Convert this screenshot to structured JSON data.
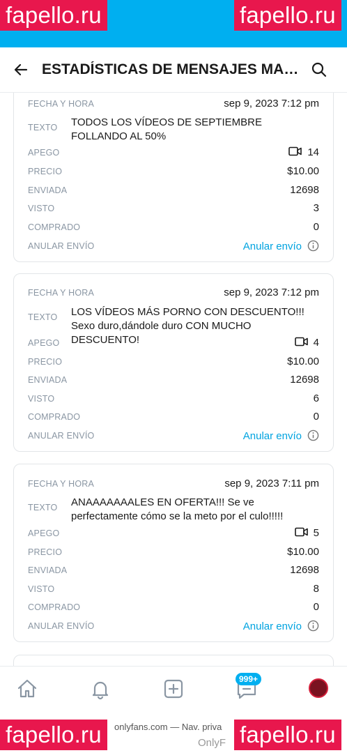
{
  "watermark": {
    "text": "fapello.ru"
  },
  "appbar": {
    "title": "ESTADÍSTICAS DE MENSAJES MAS..."
  },
  "cards": [
    {
      "fecha_label": "FECHA Y HORA",
      "fecha": "sep 9, 2023 7:12 pm",
      "texto_label": "TEXTO",
      "texto": "TODOS LOS VÍDEOS DE SEPTIEMBRE FOLLANDO AL 50%",
      "apego_label": "APEGO",
      "apego": "14",
      "precio_label": "PRECIO",
      "precio": "$10.00",
      "enviada_label": "ENVIADA",
      "enviada": "12698",
      "visto_label": "VISTO",
      "visto": "3",
      "comprado_label": "COMPRADO",
      "comprado": "0",
      "anular_label": "ANULAR ENVÍO",
      "anular_link": "Anular envío"
    },
    {
      "fecha_label": "FECHA Y HORA",
      "fecha": "sep 9, 2023 7:12 pm",
      "texto_label": "TEXTO",
      "texto": "LOS VÍDEOS MÁS PORNO CON DESCUENTO!!! Sexo duro,dándole duro CON MUCHO DESCUENTO!",
      "apego_label": "APEGO",
      "apego": "4",
      "precio_label": "PRECIO",
      "precio": "$10.00",
      "enviada_label": "ENVIADA",
      "enviada": "12698",
      "visto_label": "VISTO",
      "visto": "6",
      "comprado_label": "COMPRADO",
      "comprado": "0",
      "anular_label": "ANULAR ENVÍO",
      "anular_link": "Anular envío"
    },
    {
      "fecha_label": "FECHA Y HORA",
      "fecha": "sep 9, 2023 7:11 pm",
      "texto_label": "TEXTO",
      "texto": "ANAAAAAAALES EN OFERTA!!! Se ve perfectamente cómo se la meto por el culo!!!!!",
      "apego_label": "APEGO",
      "apego": "5",
      "precio_label": "PRECIO",
      "precio": "$10.00",
      "enviada_label": "ENVIADA",
      "enviada": "12698",
      "visto_label": "VISTO",
      "visto": "8",
      "comprado_label": "COMPRADO",
      "comprado": "0",
      "anular_label": "ANULAR ENVÍO",
      "anular_link": "Anular envío"
    }
  ],
  "bottom_nav": {
    "items": [
      "home-icon",
      "bell-icon",
      "add-post-icon",
      "messages-icon",
      "avatar"
    ],
    "badge": "999+"
  },
  "footer": {
    "text": "onlyfans.com — Nav. priva",
    "text2": "OnlyF"
  },
  "colors": {
    "accent": "#00aff0",
    "link": "#00a3e0",
    "watermark": "#e8174d"
  }
}
